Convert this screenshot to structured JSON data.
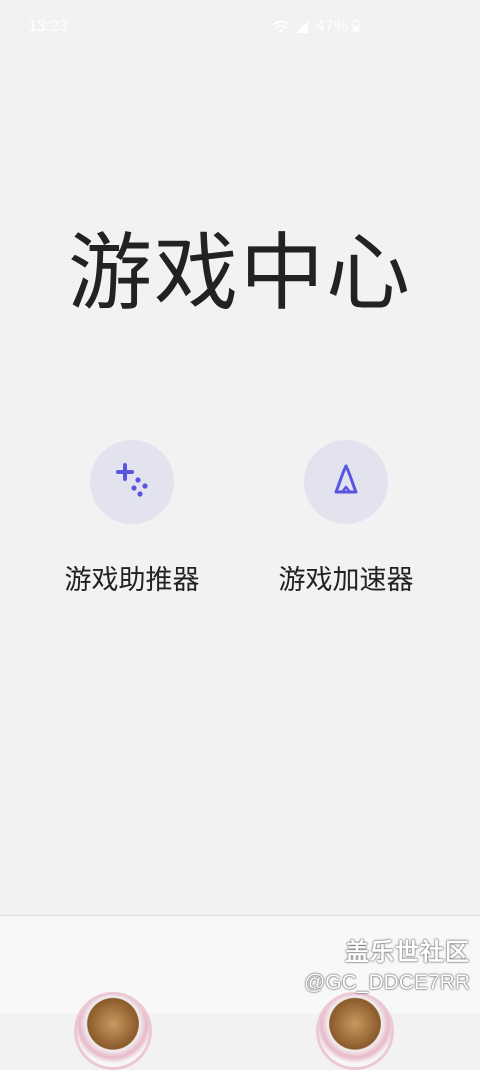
{
  "status_bar": {
    "time": "13:23",
    "battery": "47%"
  },
  "page": {
    "title": "游戏中心"
  },
  "tiles": [
    {
      "label": "游戏助推器",
      "icon": "gamepad-sparkle-icon"
    },
    {
      "label": "游戏加速器",
      "icon": "rocket-icon"
    }
  ],
  "watermark": {
    "brand": "盖乐世社区",
    "id": "@GC_DDCE7RR"
  },
  "colors": {
    "background": "#f2f2f2",
    "icon_accent": "#5a55e0",
    "icon_circle": "#e3e3ef",
    "text": "#222222"
  }
}
